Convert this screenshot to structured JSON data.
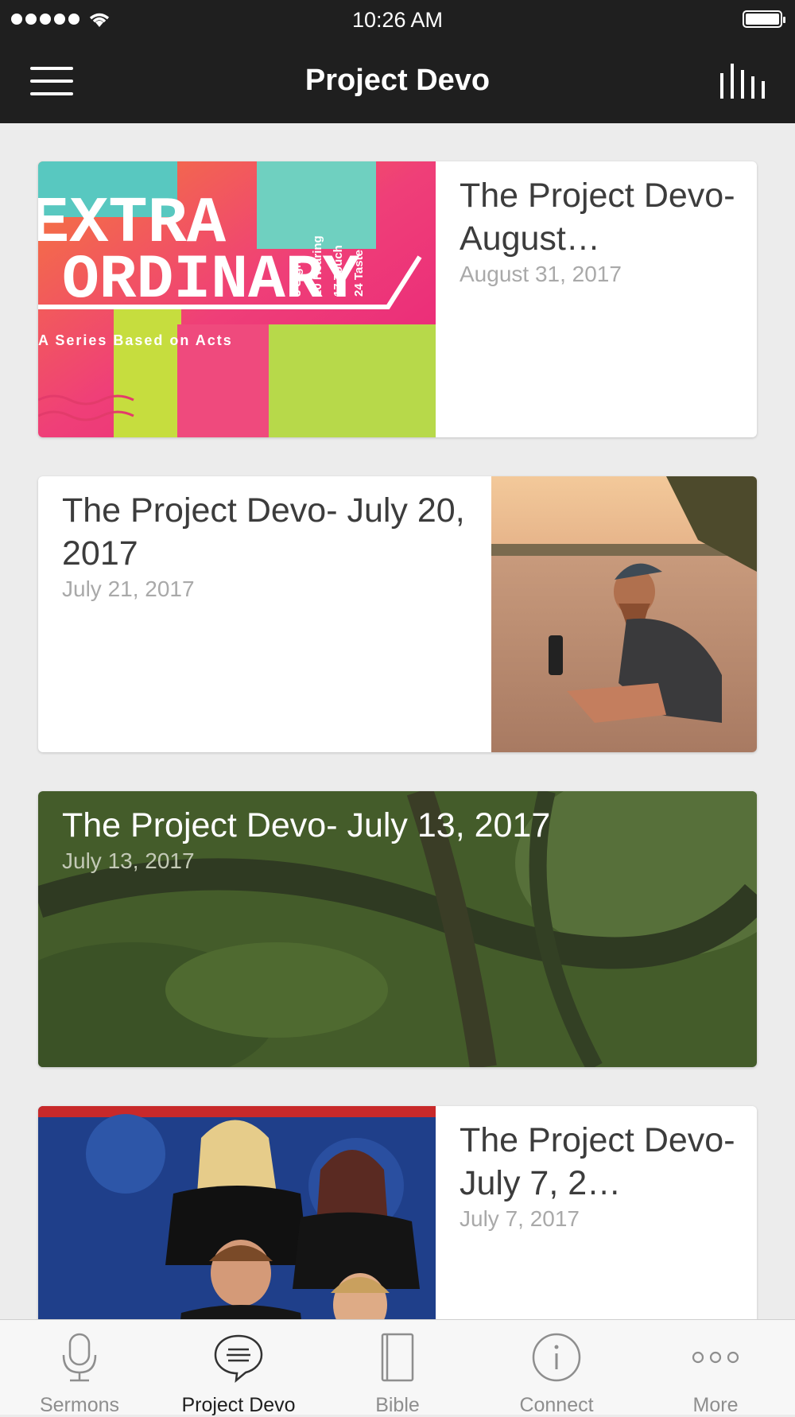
{
  "status_bar": {
    "time": "10:26 AM"
  },
  "nav": {
    "title": "Project Devo"
  },
  "devos": [
    {
      "title": "The Project Devo- August…",
      "date": "August 31, 2017",
      "image": "extraordinary-acts-series-art",
      "image_text": {
        "line1": "EXTRA",
        "line2": "ORDINARY",
        "subtitle": "A Series Based on Acts",
        "senses": [
          "3 Sight",
          "10 Hearing",
          "17 Touch",
          "24 Taste"
        ]
      }
    },
    {
      "title": "The Project Devo- July 20, 2017",
      "date": "July 21, 2017",
      "image": "man-sitting-on-beach-at-sunset"
    },
    {
      "title": "The Project Devo- July 13, 2017",
      "date": "July 13, 2017",
      "image": "green-forest-branches-background"
    },
    {
      "title": "The Project Devo- July 7, 2…",
      "date": "July 7, 2017",
      "image": "band-group-photo"
    }
  ],
  "tabs": [
    {
      "label": "Sermons",
      "icon": "microphone-icon"
    },
    {
      "label": "Project Devo",
      "icon": "speech-bubble-icon",
      "active": true
    },
    {
      "label": "Bible",
      "icon": "book-icon"
    },
    {
      "label": "Connect",
      "icon": "info-icon"
    },
    {
      "label": "More",
      "icon": "more-dots-icon"
    }
  ],
  "colors": {
    "bar": "#1f1f1f",
    "background": "#ececec",
    "title_text": "#3c3c3c",
    "date_text": "#a9a9a9"
  }
}
